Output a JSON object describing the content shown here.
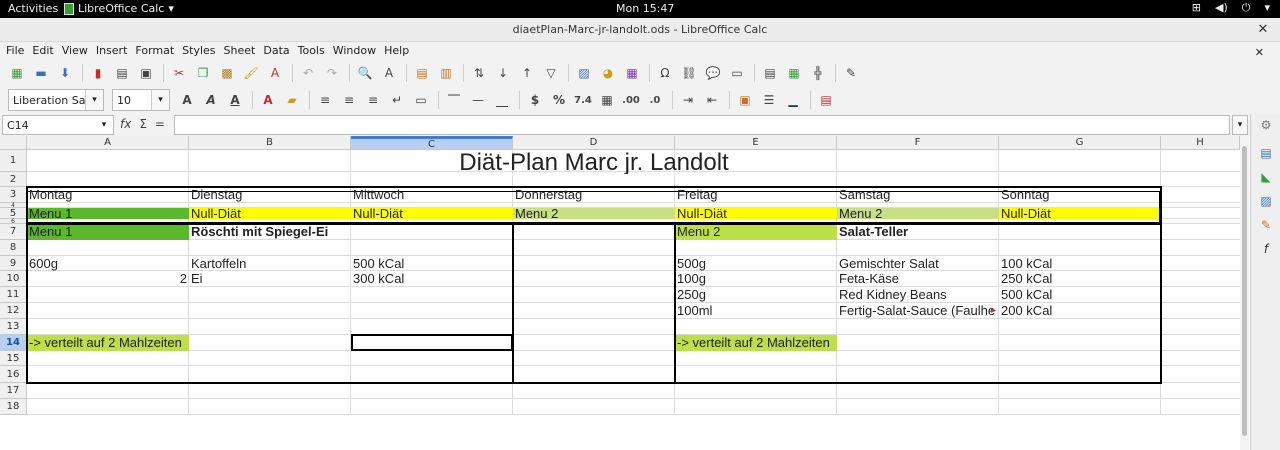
{
  "system": {
    "activities": "Activities",
    "app_name": "LibreOffice Calc",
    "clock": "Mon 15:47"
  },
  "window": {
    "title": "diaetPlan-Marc-jr-landolt.ods - LibreOffice Calc"
  },
  "menu": [
    "File",
    "Edit",
    "View",
    "Insert",
    "Format",
    "Styles",
    "Sheet",
    "Data",
    "Tools",
    "Window",
    "Help"
  ],
  "toolbar": {
    "font_name": "Liberation Sa",
    "font_size": "10"
  },
  "formula_bar": {
    "cell_ref": "C14",
    "content": ""
  },
  "columns": [
    "A",
    "B",
    "C",
    "D",
    "E",
    "F",
    "G",
    "H"
  ],
  "selected_column": "C",
  "rows": [
    "1",
    "2",
    "3",
    "4",
    "5",
    "6",
    "7",
    "8",
    "9",
    "10",
    "11",
    "12",
    "13",
    "14",
    "15",
    "16",
    "17",
    "18"
  ],
  "selected_row": "14",
  "cells": {
    "title": "Diät-Plan Marc jr. Landolt",
    "days": [
      "Montag",
      "Dienstag",
      "Mittwoch",
      "Donnerstag",
      "Freitag",
      "Samstag",
      "Sonntag"
    ],
    "plan": [
      "Menu 1",
      "Null-Diät",
      "Null-Diät",
      "Menu 2",
      "Null-Diät",
      "Menu 2",
      "Null-Diät"
    ],
    "menu1": {
      "label": "Menu 1",
      "name": "Röschti mit Spiegel-Ei",
      "rows": [
        {
          "qty": "600g",
          "item": "Kartoffeln",
          "kcal": "500 kCal"
        },
        {
          "qty": "2",
          "item": "Ei",
          "kcal": "300 kCal"
        }
      ],
      "note": "-> verteilt auf 2 Mahlzeiten"
    },
    "menu2": {
      "label": "Menu 2",
      "name": "Salat-Teller",
      "rows": [
        {
          "qty": "500g",
          "item": "Gemischter Salat",
          "kcal": "100 kCal"
        },
        {
          "qty": "100g",
          "item": "Feta-Käse",
          "kcal": "250 kCal"
        },
        {
          "qty": "250g",
          "item": "Red Kidney Beans",
          "kcal": "500 kCal"
        },
        {
          "qty": "100ml",
          "item": "Fertig-Salat-Sauce (Faulhe",
          "kcal": "200 kCal"
        }
      ],
      "note": "-> verteilt auf 2 Mahlzeiten"
    }
  },
  "colors": {
    "menu1_green": "#5cb82c",
    "menu2_green": "#c9df85",
    "lime": "#bde04a",
    "yellow": "#ffff00",
    "selection": "#b6d0ef"
  }
}
